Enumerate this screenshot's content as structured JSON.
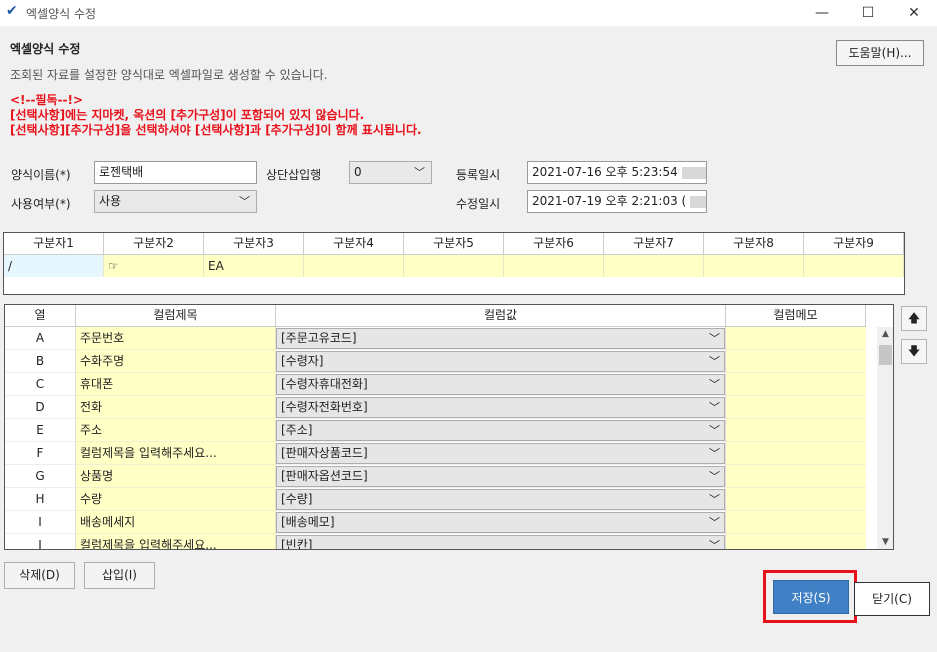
{
  "window": {
    "title": "엑셀양식 수정"
  },
  "header": {
    "title": "엑셀양식 수정",
    "description": "조회된 자료를 설정한 양식대로 엑셀파일로 생성할 수 있습니다.",
    "help_label": "도움말(H)..."
  },
  "notice": [
    "<!--필독--!>",
    "[선택사항]에는 지마켓, 옥션의 [추가구성]이 포함되어 있지 않습니다.",
    "[선택사항][추가구성]을 선택하셔야 [선택사항]과 [추가구성]이 함께 표시됩니다."
  ],
  "form": {
    "name_label": "양식이름(*)",
    "name_value": "로젠택배",
    "use_label": "사용여부(*)",
    "use_value": "사용",
    "top_insert_label": "상단삽입행",
    "top_insert_value": "0",
    "reg_date_label": "등록일시",
    "reg_date_value": "2021-07-16 오후 5:23:54",
    "mod_date_label": "수정일시",
    "mod_date_value": "2021-07-19 오후 2:21:03 ("
  },
  "separator_grid": {
    "headers": [
      "구분자1",
      "구분자2",
      "구분자3",
      "구분자4",
      "구분자5",
      "구분자6",
      "구분자7",
      "구분자8",
      "구분자9"
    ],
    "values": [
      "/",
      "☞",
      "EA",
      "",
      "",
      "",
      "",
      "",
      ""
    ]
  },
  "column_grid": {
    "headers": [
      "열",
      "컬럼제목",
      "컬럼값",
      "컬럼메모"
    ],
    "rows": [
      {
        "col": "A",
        "title": "주문번호",
        "value": "[주문고유코드]",
        "memo": ""
      },
      {
        "col": "B",
        "title": "수화주명",
        "value": "[수령자]",
        "memo": ""
      },
      {
        "col": "C",
        "title": "휴대폰",
        "value": "[수령자휴대전화]",
        "memo": ""
      },
      {
        "col": "D",
        "title": "전화",
        "value": "[수령자전화번호]",
        "memo": ""
      },
      {
        "col": "E",
        "title": "주소",
        "value": "[주소]",
        "memo": ""
      },
      {
        "col": "F",
        "title": "컬럼제목을 입력해주세요...",
        "value": "[판매자상품코드]",
        "memo": ""
      },
      {
        "col": "G",
        "title": "상품명",
        "value": "[판매자옵션코드]",
        "memo": ""
      },
      {
        "col": "H",
        "title": "수량",
        "value": "[수량]",
        "memo": ""
      },
      {
        "col": "I",
        "title": "배송메세지",
        "value": "[배송메모]",
        "memo": ""
      },
      {
        "col": "J",
        "title": "컬럼제목을 입력해주세요...",
        "value": "[빈칸]",
        "memo": ""
      }
    ]
  },
  "buttons": {
    "delete": "삭제(D)",
    "insert": "삽입(I)",
    "save": "저장(S)",
    "close": "닫기(C)",
    "up": "🡅",
    "down": "🡇"
  },
  "colors": {
    "accent": "#4080c4",
    "notice": "#e8101a",
    "cell_yellow": "#ffffc6",
    "highlight_box": "#e8101a"
  }
}
